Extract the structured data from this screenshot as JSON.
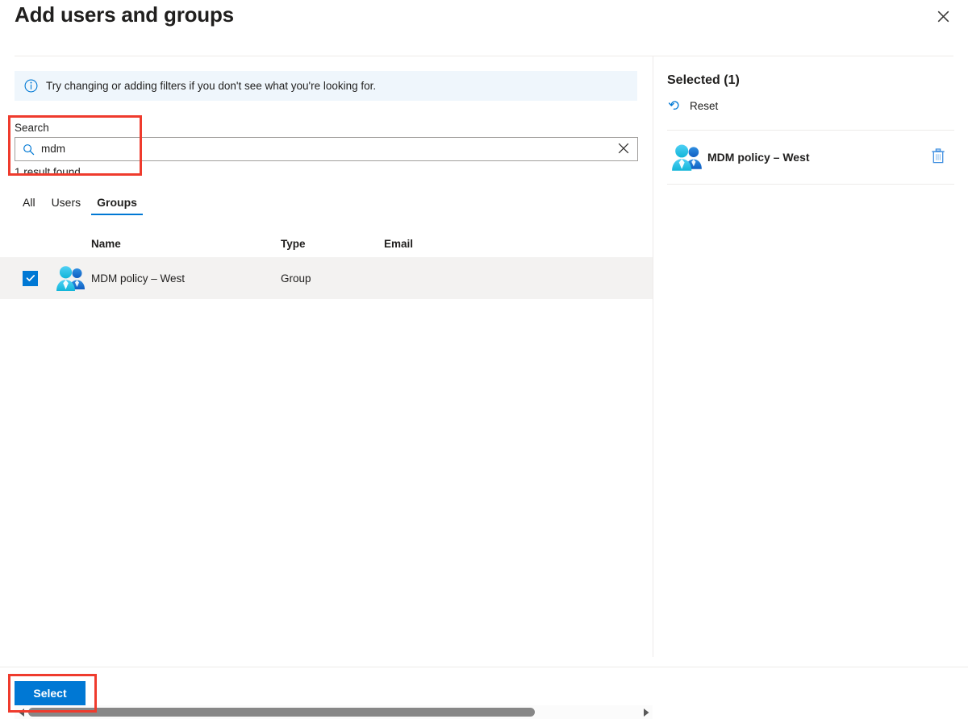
{
  "dialog": {
    "title": "Add users and groups",
    "close_label": "Close"
  },
  "info_bar": {
    "icon": "info-circle-icon",
    "message": "Try changing or adding filters if you don't see what you're looking for."
  },
  "search": {
    "label": "Search",
    "value": "mdm",
    "placeholder": "Search",
    "icon": "search-icon",
    "clear_icon": "clear-x-icon",
    "result_count": "1 result found"
  },
  "tabs": [
    {
      "label": "All",
      "active": false
    },
    {
      "label": "Users",
      "active": false
    },
    {
      "label": "Groups",
      "active": true
    }
  ],
  "table": {
    "columns": [
      "Name",
      "Type",
      "Email"
    ],
    "rows": [
      {
        "checked": true,
        "icon": "group-avatar-icon",
        "name": "MDM policy – West",
        "type": "Group",
        "email": ""
      }
    ]
  },
  "scrollbar": {
    "left_arrow": "chevron-left-icon",
    "right_arrow": "chevron-right-icon"
  },
  "selected_panel": {
    "title": "Selected (1)",
    "reset_label": "Reset",
    "reset_icon": "undo-arrow-icon",
    "items": [
      {
        "icon": "group-avatar-icon",
        "name": "MDM policy – West",
        "delete_icon": "trash-icon"
      }
    ]
  },
  "footer": {
    "select_label": "Select"
  },
  "colors": {
    "accent": "#0078d4",
    "info_bar_bg": "#eff6fc",
    "row_selected_bg": "#f3f2f1",
    "divider": "#edebe9",
    "annotation": "#ef3b2d",
    "scroll_thumb": "#878787"
  }
}
